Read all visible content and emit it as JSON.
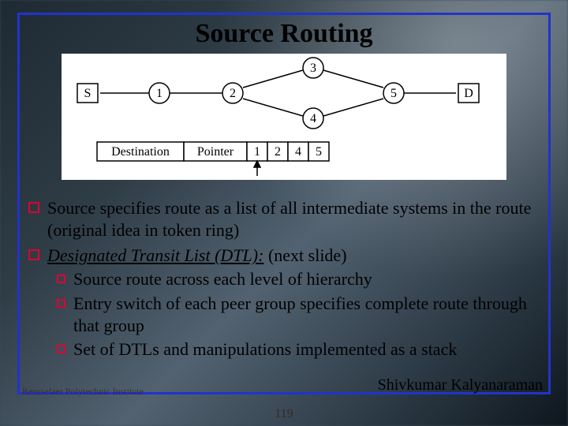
{
  "title": "Source Routing",
  "diagram": {
    "nodes": [
      "S",
      "1",
      "2",
      "3",
      "4",
      "5",
      "D"
    ],
    "header_cells": [
      "Destination",
      "Pointer",
      "1",
      "2",
      "4",
      "5"
    ]
  },
  "bullets": [
    {
      "text": "Source specifies route as a list of all intermediate systems in the route (original idea in token ring)"
    },
    {
      "emph": "Designated Transit List (DTL):",
      "tail": " (next slide)",
      "children": [
        "Source route across each level of hierarchy",
        "Entry switch of each peer group specifies complete route through that group",
        "Set of DTLs and manipulations implemented as a stack"
      ]
    }
  ],
  "footer": {
    "left": "Rensselaer Polytechnic Institute",
    "right": "Shivkumar Kalyanaraman",
    "page": "119"
  }
}
